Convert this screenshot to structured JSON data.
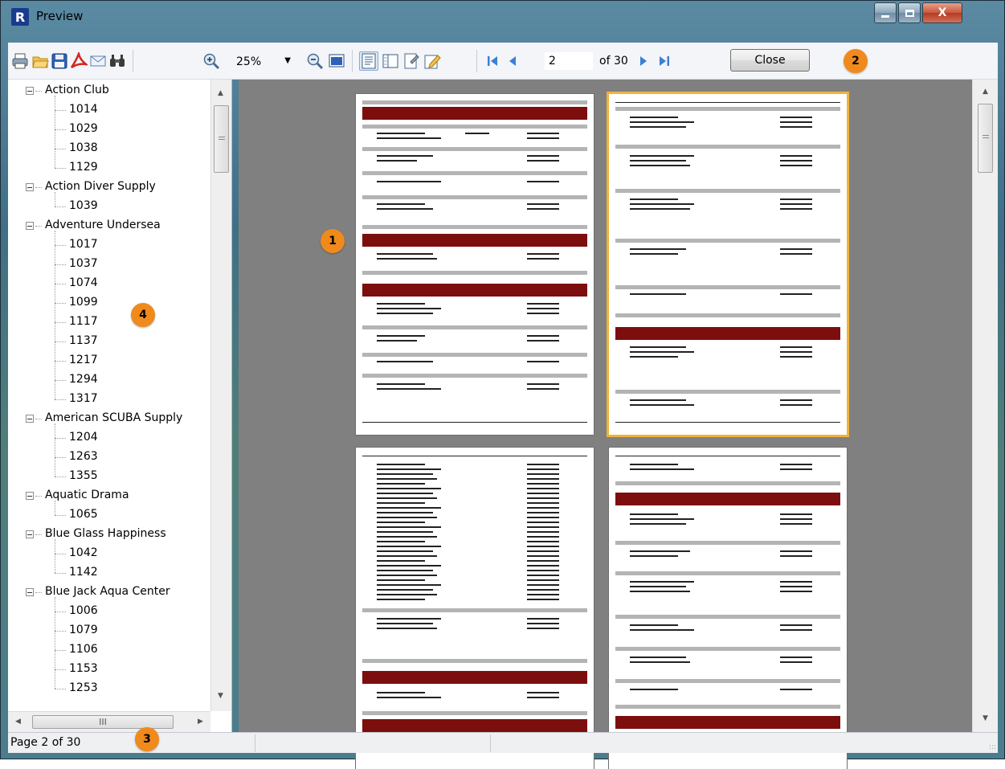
{
  "window": {
    "title": "Preview",
    "app_icon_letter": "R",
    "controls": {
      "minimize": "—",
      "maximize": "□",
      "close": "X"
    }
  },
  "toolbar": {
    "zoom_value": "25%",
    "current_page": "2",
    "page_count_label": "of 30",
    "close_label": "Close",
    "icons": [
      "print-icon",
      "open-icon",
      "save-icon",
      "pdf-icon",
      "email-icon",
      "find-icon",
      "zoom-in-icon",
      "zoom-out-icon",
      "full-screen-icon",
      "outline-icon",
      "thumbnails-icon",
      "page-setup-icon",
      "edit-icon",
      "first-page-icon",
      "prev-page-icon",
      "next-page-icon",
      "last-page-icon"
    ]
  },
  "tree": {
    "groups": [
      {
        "label": "Action Club",
        "items": [
          "1014",
          "1029",
          "1038",
          "1129"
        ]
      },
      {
        "label": "Action Diver Supply",
        "items": [
          "1039"
        ]
      },
      {
        "label": "Adventure Undersea",
        "items": [
          "1017",
          "1037",
          "1074",
          "1099",
          "1117",
          "1137",
          "1217",
          "1294",
          "1317"
        ]
      },
      {
        "label": "American SCUBA Supply",
        "items": [
          "1204",
          "1263",
          "1355"
        ]
      },
      {
        "label": "Aquatic Drama",
        "items": [
          "1065"
        ]
      },
      {
        "label": "Blue Glass Happiness",
        "items": [
          "1042",
          "1142"
        ]
      },
      {
        "label": "Blue Jack Aqua Center",
        "items": [
          "1006",
          "1079",
          "1106",
          "1153",
          "1253"
        ]
      }
    ],
    "hscroll_grip": "III"
  },
  "status": {
    "text": "Page 2 of 30",
    "grip": ":::"
  },
  "callouts": [
    "1",
    "2",
    "3",
    "4"
  ],
  "colors": {
    "accent_red": "#7d0e0e",
    "callout": "#f08a1d",
    "selected_page_border": "#f0b33c",
    "preview_bg": "#808080"
  }
}
